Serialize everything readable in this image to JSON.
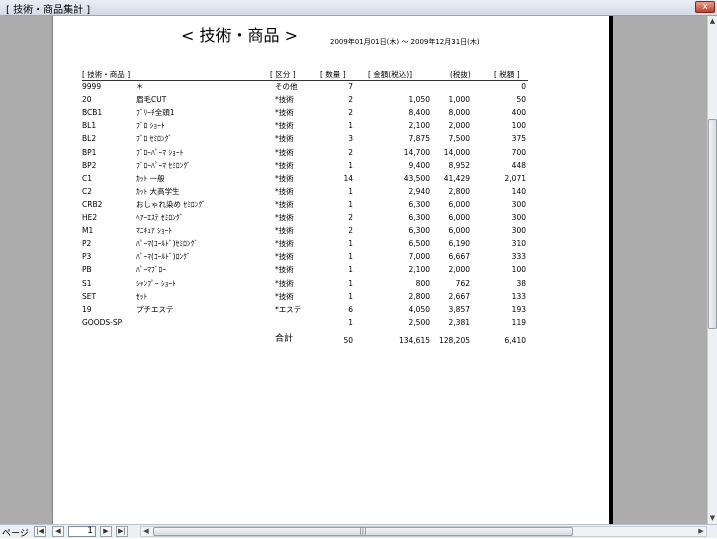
{
  "window": {
    "title": "[ 技術・商品集計 ]",
    "close_label": "x"
  },
  "report": {
    "title": "< 技術・商品 >",
    "period": "2009年01月01日(木) ～ 2009年12月31日(木)",
    "headers": {
      "item": "[ 技術・商品 ]",
      "category": "[ 区分 ]",
      "qty": "[ 数量 ]",
      "amount_incl": "[ 金額(税込)]",
      "amount_excl": "(税抜)",
      "tax": "[ 税額 ]"
    },
    "rows": [
      {
        "code": "9999",
        "name": "＊",
        "category": "その他",
        "qty": "7",
        "incl": "",
        "excl": "",
        "tax": "0"
      },
      {
        "code": "20",
        "name": "眉毛CUT",
        "category": "*技術",
        "qty": "2",
        "incl": "1,050",
        "excl": "1,000",
        "tax": "50"
      },
      {
        "code": "BCB1",
        "name": "ﾌﾞﾘｰﾁ全頭1",
        "category": "*技術",
        "qty": "2",
        "incl": "8,400",
        "excl": "8,000",
        "tax": "400"
      },
      {
        "code": "BL1",
        "name": "ﾌﾞﾛ ｼｮｰﾄ",
        "category": "*技術",
        "qty": "1",
        "incl": "2,100",
        "excl": "2,000",
        "tax": "100"
      },
      {
        "code": "BL2",
        "name": "ﾌﾞﾛ ｾﾐﾛﾝｸﾞ",
        "category": "*技術",
        "qty": "3",
        "incl": "7,875",
        "excl": "7,500",
        "tax": "375"
      },
      {
        "code": "BP1",
        "name": "ﾌﾞﾛｰﾊﾟｰﾏ ｼｮｰﾄ",
        "category": "*技術",
        "qty": "2",
        "incl": "14,700",
        "excl": "14,000",
        "tax": "700"
      },
      {
        "code": "BP2",
        "name": "ﾌﾞﾛｰﾊﾟｰﾏ ｾﾐﾛﾝｸﾞ",
        "category": "*技術",
        "qty": "1",
        "incl": "9,400",
        "excl": "8,952",
        "tax": "448"
      },
      {
        "code": "C1",
        "name": "ｶｯﾄ 一般",
        "category": "*技術",
        "qty": "14",
        "incl": "43,500",
        "excl": "41,429",
        "tax": "2,071"
      },
      {
        "code": "C2",
        "name": "ｶｯﾄ 大高学生",
        "category": "*技術",
        "qty": "1",
        "incl": "2,940",
        "excl": "2,800",
        "tax": "140"
      },
      {
        "code": "CRB2",
        "name": "おしゃれ染め ｾﾐﾛﾝｸﾞ",
        "category": "*技術",
        "qty": "1",
        "incl": "6,300",
        "excl": "6,000",
        "tax": "300"
      },
      {
        "code": "HE2",
        "name": "ﾍｱｰｴｽﾃ ｾﾐﾛﾝｸﾞ",
        "category": "*技術",
        "qty": "2",
        "incl": "6,300",
        "excl": "6,000",
        "tax": "300"
      },
      {
        "code": "M1",
        "name": "ﾏﾆｷｭｱ ｼｮｰﾄ",
        "category": "*技術",
        "qty": "2",
        "incl": "6,300",
        "excl": "6,000",
        "tax": "300"
      },
      {
        "code": "P2",
        "name": "ﾊﾟｰﾏ(ｺｰﾙﾄﾞ)ｾﾐﾛﾝｸﾞ",
        "category": "*技術",
        "qty": "1",
        "incl": "6,500",
        "excl": "6,190",
        "tax": "310"
      },
      {
        "code": "P3",
        "name": "ﾊﾟｰﾏ(ｺｰﾙﾄﾞ)ﾛﾝｸﾞ",
        "category": "*技術",
        "qty": "1",
        "incl": "7,000",
        "excl": "6,667",
        "tax": "333"
      },
      {
        "code": "PB",
        "name": "ﾊﾟｰﾏﾌﾞﾛｰ",
        "category": "*技術",
        "qty": "1",
        "incl": "2,100",
        "excl": "2,000",
        "tax": "100"
      },
      {
        "code": "S1",
        "name": "ｼｬﾝﾌﾟｰ ｼｮｰﾄ",
        "category": "*技術",
        "qty": "1",
        "incl": "800",
        "excl": "762",
        "tax": "38"
      },
      {
        "code": "SET",
        "name": "ｾｯﾄ",
        "category": "*技術",
        "qty": "1",
        "incl": "2,800",
        "excl": "2,667",
        "tax": "133"
      },
      {
        "code": "19",
        "name": "プチエステ",
        "category": "*エステ",
        "qty": "6",
        "incl": "4,050",
        "excl": "3,857",
        "tax": "193"
      },
      {
        "code": "GOODS-SP",
        "name": "",
        "category": "",
        "qty": "1",
        "incl": "2,500",
        "excl": "2,381",
        "tax": "119"
      }
    ],
    "total": {
      "label": "合計",
      "qty": "50",
      "incl": "134,615",
      "excl": "128,205",
      "tax": "6,410"
    }
  },
  "statusbar": {
    "page_label": "ページ",
    "page_value": "1"
  },
  "icons": {
    "first": "first-page-icon",
    "prev": "prev-page-icon",
    "next": "next-page-icon",
    "last": "last-page-icon",
    "close": "close-icon"
  }
}
